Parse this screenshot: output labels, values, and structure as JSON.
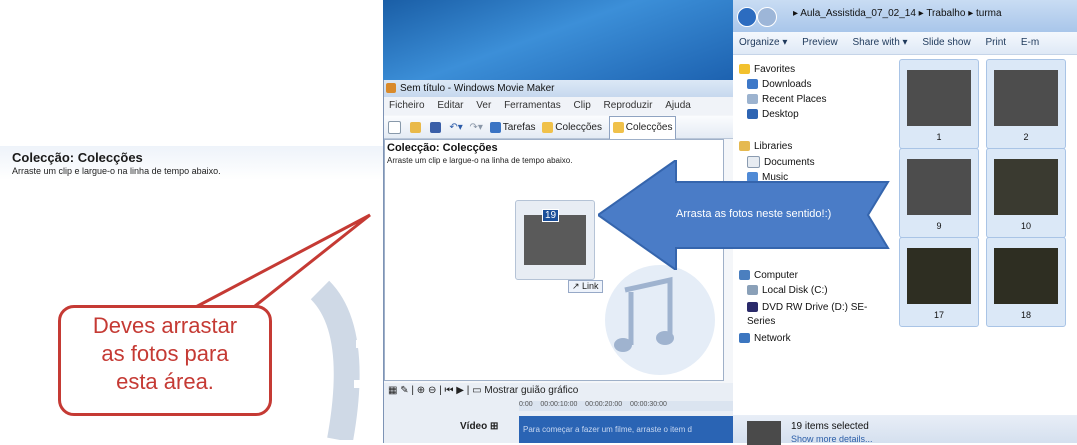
{
  "left_doc": {
    "title": "Colecção: Colecções",
    "subtitle": "Arraste um clip e largue-o na linha de tempo abaixo."
  },
  "moviemaker": {
    "title": "Sem título - Windows Movie Maker",
    "menu": [
      "Ficheiro",
      "Editar",
      "Ver",
      "Ferramentas",
      "Clip",
      "Reproduzir",
      "Ajuda"
    ],
    "toolbar": {
      "tarefas": "Tarefas",
      "coleccoes": "Colecções",
      "coleccoes2": "Colecções"
    },
    "pane_title": "Colecção: Colecções",
    "pane_subtitle": "Arraste um clip e largue-o na linha de tempo abaixo.",
    "thumb_number": "19",
    "link_label": "Link",
    "timeline_toggle": "Mostrar guião gráfico",
    "ruler": [
      "0:00",
      "00:00:10:00",
      "00:00:20:00",
      "00:00:30:00"
    ],
    "video_label": "Vídeo",
    "video_hint": "Para começar a fazer um filme, arraste o item d"
  },
  "explorer": {
    "breadcrumb": [
      "Aula_Assistida_07_02_14",
      "Trabalho",
      "turma"
    ],
    "commands": [
      "Organize ▾",
      "Preview",
      "Share with ▾",
      "Slide show",
      "Print",
      "E-m"
    ],
    "nav": {
      "favorites": "Favorites",
      "downloads": "Downloads",
      "recent": "Recent Places",
      "desktop": "Desktop",
      "libraries": "Libraries",
      "documents": "Documents",
      "music": "Music",
      "computer": "Computer",
      "local_disk": "Local Disk (C:)",
      "dvd": "DVD RW Drive (D:) SE-Series",
      "network": "Network"
    },
    "files": [
      "1",
      "2",
      "9",
      "10",
      "17",
      "18"
    ],
    "status": {
      "selected": "19 items selected",
      "more": "Show more details..."
    }
  },
  "arrow_text": "Arrasta as fotos neste sentido!:)",
  "callout_text": [
    "Deves arrastar",
    "as fotos para",
    "esta área."
  ],
  "colors": {
    "arrow": "#4a7cc7",
    "callout": "#c53a34",
    "selected": "#dbe8f7"
  }
}
